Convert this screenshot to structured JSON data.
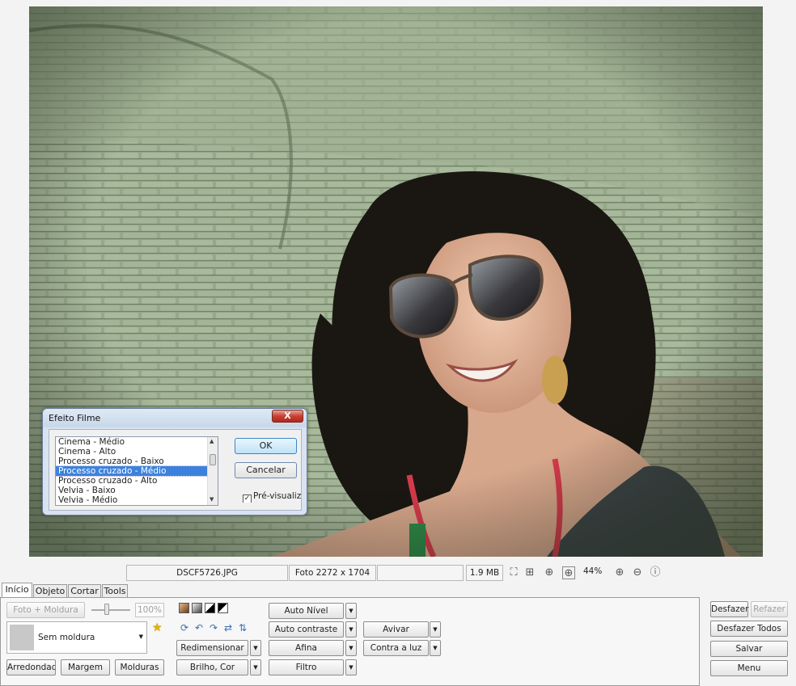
{
  "dialog": {
    "title": "Efeito Filme",
    "close_label": "X",
    "items": [
      "Cinema - Médio",
      "Cinema - Alto",
      "Processo cruzado - Baixo",
      "Processo cruzado - Médio",
      "Processo cruzado - Alto",
      "Velvia - Baixo",
      "Velvia - Médio"
    ],
    "selected_index": 3,
    "ok_label": "OK",
    "cancel_label": "Cancelar",
    "preview_label": "Pré-visualiz",
    "preview_checked": true
  },
  "status": {
    "filename": "DSCF5726.JPG",
    "dimensions": "Foto 2272 x 1704",
    "filesize": "1.9 MB",
    "zoom": "44%"
  },
  "tabs": [
    "Início",
    "Objeto",
    "Cortar",
    "Tools"
  ],
  "panel": {
    "photo_frame_label": "Foto + Moldura",
    "opacity": "100%",
    "frame_name": "Sem moldura",
    "rounded_label": "Arredondado",
    "margin_label": "Margem",
    "frames_label": "Molduras",
    "resize_label": "Redimensionar",
    "brightness_label": "Brilho, Cor",
    "auto_level_label": "Auto Nível",
    "auto_contrast_label": "Auto contraste",
    "sharpen_label": "Afina",
    "filter_label": "Filtro",
    "enliven_label": "Avivar",
    "backlight_label": "Contra a luz"
  },
  "side": {
    "undo_label": "Desfazer",
    "redo_label": "Refazer",
    "undo_all_label": "Desfazer Todos",
    "save_label": "Salvar",
    "menu_label": "Menu"
  },
  "colors": {
    "selection": "#3c82dc",
    "wall": "#97a88a",
    "hair": "#1a1712",
    "skin": "#e2b79a"
  }
}
